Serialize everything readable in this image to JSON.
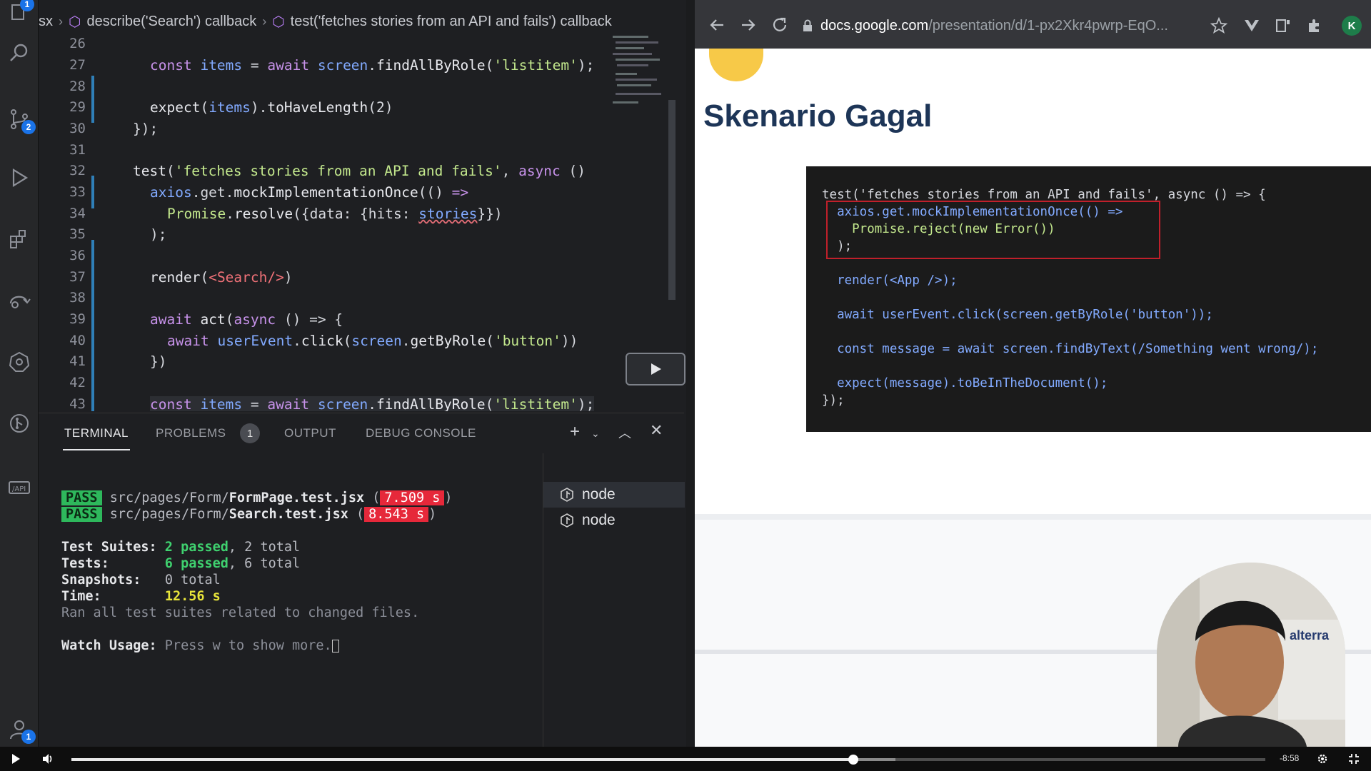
{
  "vscode": {
    "breadcrumb": {
      "file_fragment": "sx",
      "crumb1": "describe('Search') callback",
      "crumb2": "test('fetches stories from an API and fails') callback"
    },
    "activity_badges": {
      "top": "1",
      "scm": "2",
      "account": "1"
    },
    "line_numbers": [
      "26",
      "27",
      "28",
      "29",
      "30",
      "31",
      "32",
      "33",
      "34",
      "35",
      "36",
      "37",
      "38",
      "39",
      "40",
      "41",
      "42",
      "43"
    ],
    "code": {
      "l27": [
        "const ",
        "items",
        " = ",
        "await ",
        "screen",
        ".",
        "findAllByRole",
        "(",
        "'listitem'",
        ");"
      ],
      "l29": [
        "expect",
        "(",
        "items",
        ").",
        "toHaveLength",
        "(2)"
      ],
      "l30": "});",
      "l32": [
        "test",
        "(",
        "'fetches stories from an API and fails'",
        ", ",
        "async",
        " ()"
      ],
      "l33": [
        "axios",
        ".get.",
        "mockImplementationOnce",
        "(() ",
        "=>"
      ],
      "l34": [
        "Promise",
        ".",
        "resolve",
        "({data: {hits: ",
        "stories",
        "}})"
      ],
      "l35": ");",
      "l37": [
        "render",
        "(",
        "<Search/>",
        ")"
      ],
      "l39": [
        "await ",
        "act",
        "(",
        "async",
        " () => {"
      ],
      "l40": [
        "await ",
        "userEvent",
        ".",
        "click",
        "(",
        "screen",
        ".",
        "getByRole",
        "(",
        "'button'",
        "))"
      ],
      "l41": "})",
      "l43": [
        "const ",
        "items",
        " = ",
        "await ",
        "screen",
        ".",
        "findAllByRole",
        "(",
        "'listitem'",
        ");"
      ]
    },
    "panel": {
      "tabs": [
        "TERMINAL",
        "PROBLEMS",
        "OUTPUT",
        "DEBUG CONSOLE"
      ],
      "problems_count": "1",
      "terminals": [
        "node",
        "node"
      ],
      "output": {
        "pass_label": "PASS",
        "file1_dir": "src/pages/Form/",
        "file1_name": "FormPage.test.jsx",
        "file1_time": "7.509 s",
        "file2_dir": "src/pages/Form/",
        "file2_name": "Search.test.jsx",
        "file2_time": "8.543 s",
        "suites_label": "Test Suites:",
        "suites_passed": "2 passed",
        "suites_total": ", 2 total",
        "tests_label": "Tests:",
        "tests_passed": "6 passed",
        "tests_total": ", 6 total",
        "snapshots_label": "Snapshots:",
        "snapshots_value": "0 total",
        "time_label": "Time:",
        "time_value": "12.56 s",
        "ran_all": "Ran all test suites related to changed files.",
        "watch_label": "Watch Usage:",
        "watch_text": " Press w to show more."
      }
    }
  },
  "browser": {
    "url_host": "docs.google.com",
    "url_path": "/presentation/d/1-px2Xkr4pwrp-EqO...",
    "profile_initial": "K",
    "slide": {
      "title": "Skenario Gagal",
      "code_lines": [
        "test('fetches stories from an API and fails', async () => {",
        "  axios.get.mockImplementationOnce(() =>",
        "    Promise.reject(new Error())",
        "  );",
        "",
        "  render(<App />);",
        "",
        "  await userEvent.click(screen.getByRole('button'));",
        "",
        "  const message = await screen.findByText(/Something went wrong/);",
        "",
        "  expect(message).toBeInTheDocument();",
        "});"
      ]
    },
    "webcam_logo": "alterra"
  },
  "player": {
    "time_remaining": "-8:58",
    "progress": 0.655,
    "buffered": 0.69
  }
}
